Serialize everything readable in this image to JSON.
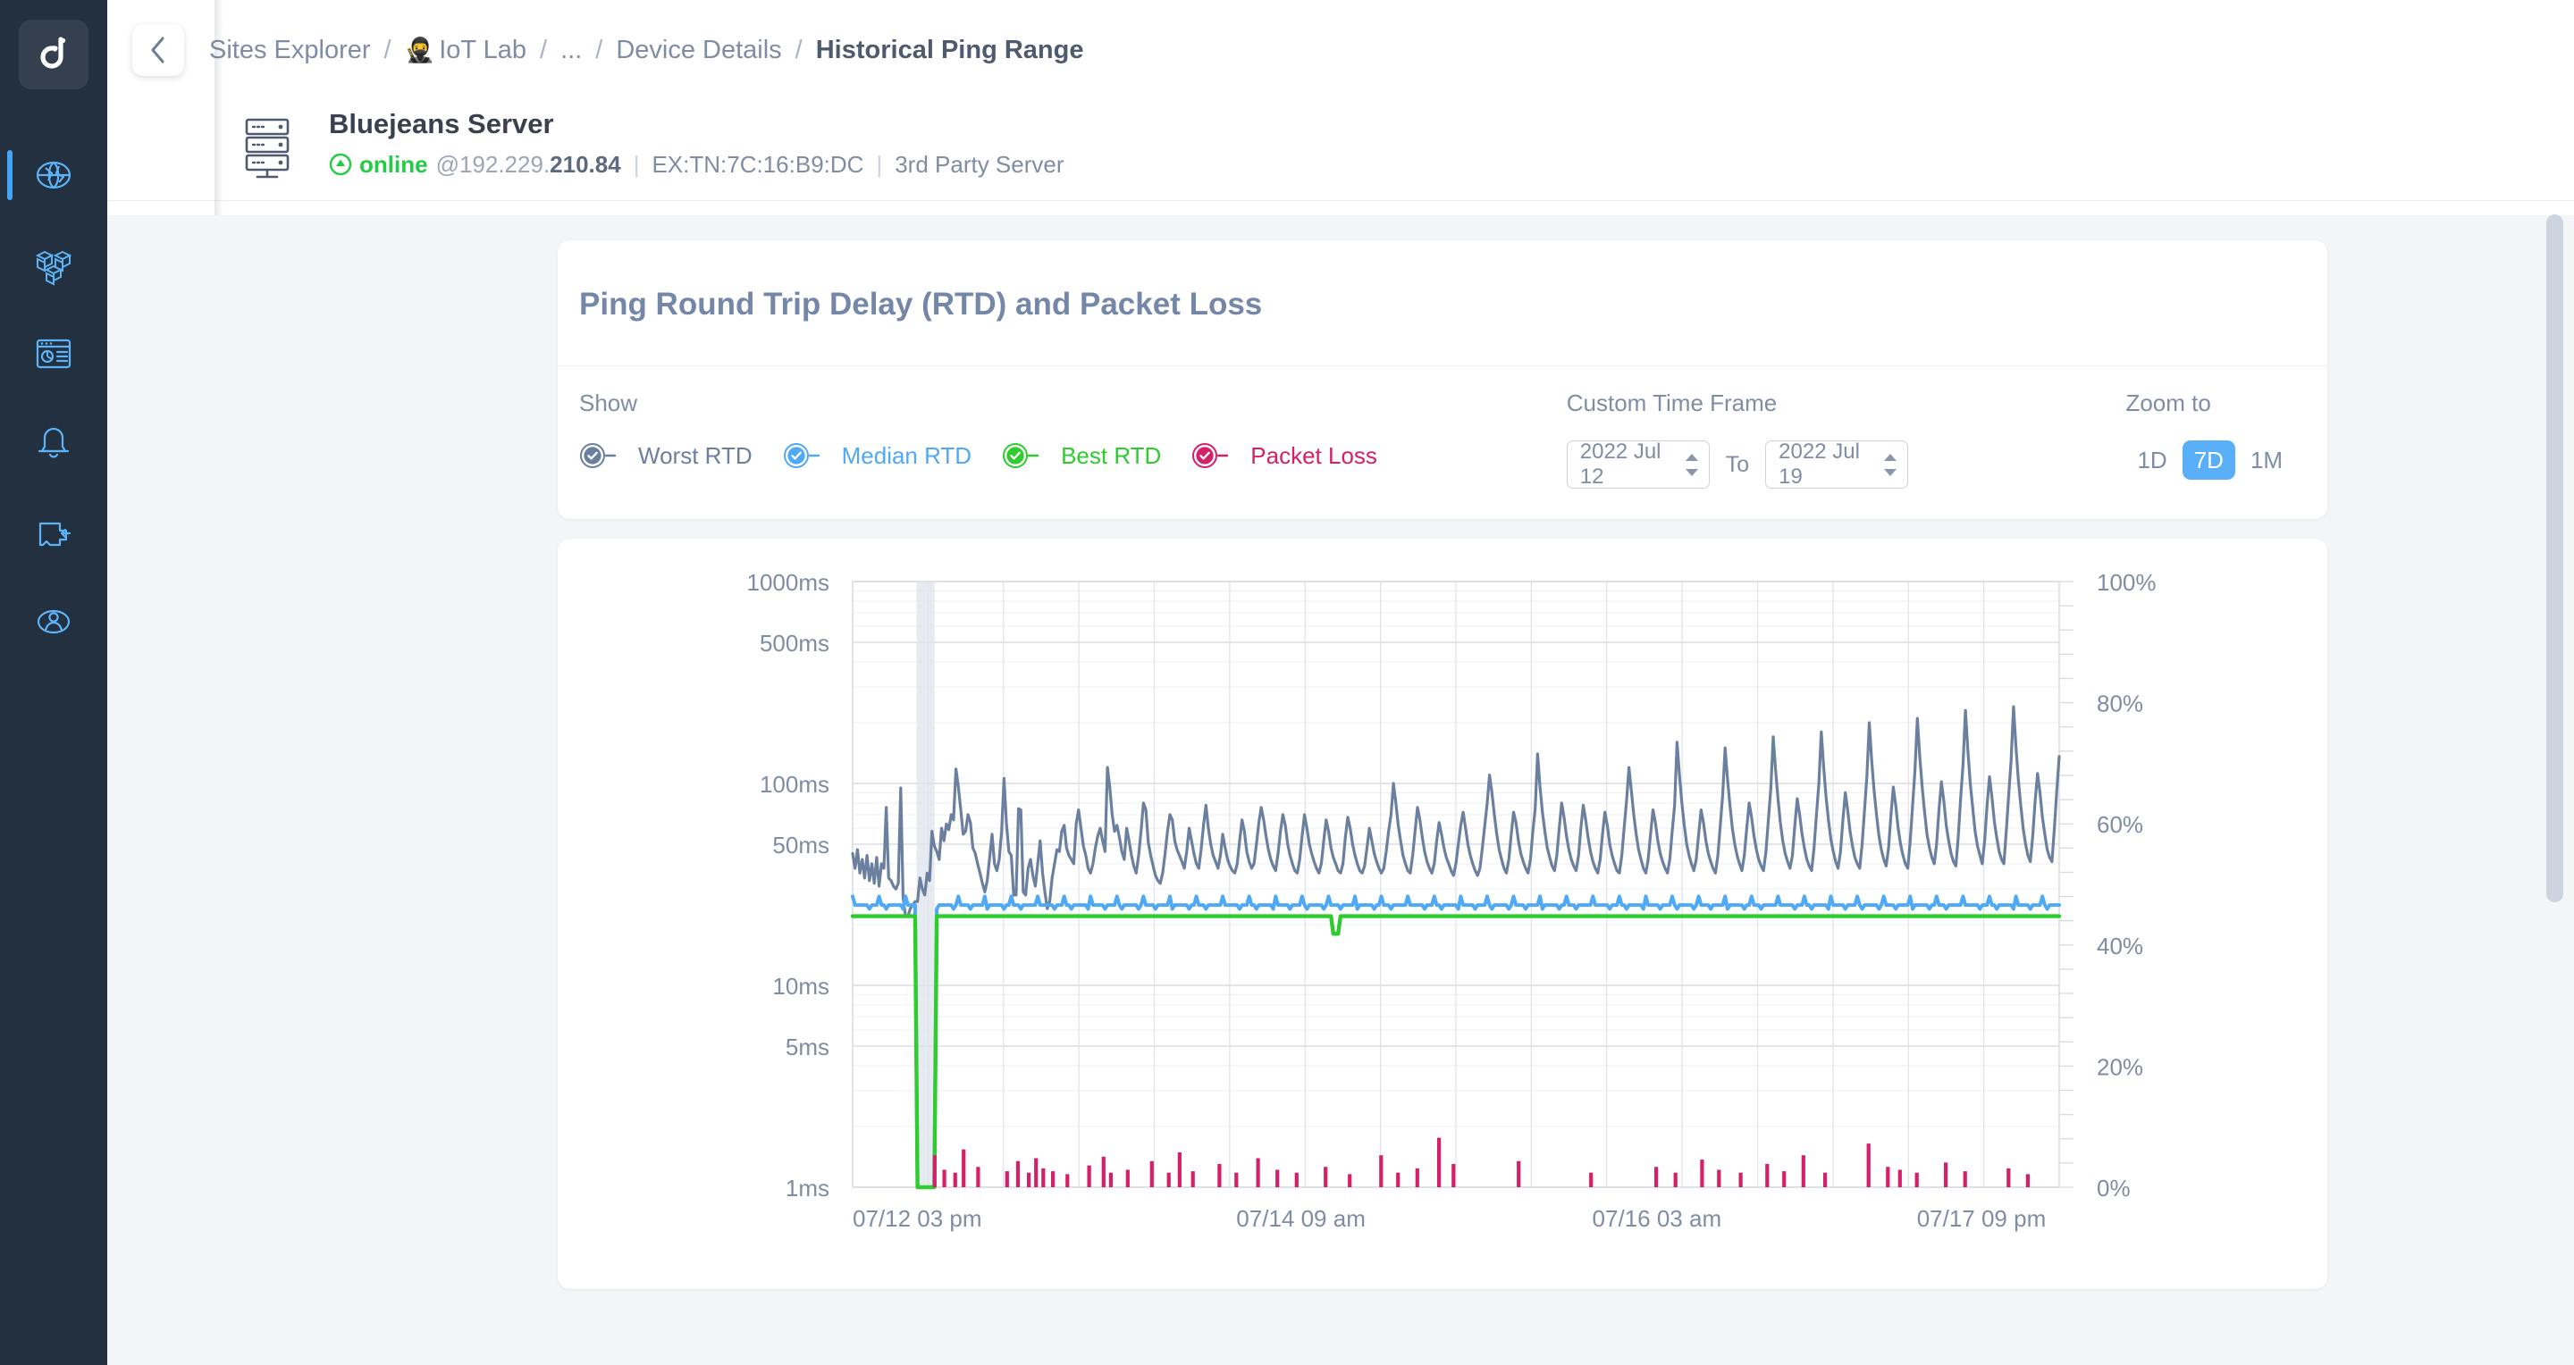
{
  "sidebar": {
    "logo_icon": "decision-logo-icon",
    "items": [
      {
        "icon": "globe-network-icon",
        "name": "sites",
        "active": true
      },
      {
        "icon": "cubes-inventory-icon",
        "name": "inventory",
        "active": false
      },
      {
        "icon": "dashboard-report-icon",
        "name": "reports",
        "active": false
      },
      {
        "icon": "bell-alerts-icon",
        "name": "alerts",
        "active": false
      },
      {
        "icon": "integration-icon",
        "name": "integrations",
        "active": false
      },
      {
        "icon": "user-profile-icon",
        "name": "profile",
        "active": false
      }
    ]
  },
  "header": {
    "back_icon": "chevron-left-icon",
    "breadcrumbs": [
      {
        "label": "Sites Explorer",
        "current": false,
        "emoji": ""
      },
      {
        "label": "IoT Lab",
        "current": false,
        "emoji": "🥷"
      },
      {
        "label": "...",
        "current": false,
        "emoji": ""
      },
      {
        "label": "Device Details",
        "current": false,
        "emoji": ""
      },
      {
        "label": "Historical Ping Range",
        "current": true,
        "emoji": ""
      }
    ],
    "separator": "/"
  },
  "device": {
    "icon": "server-rack-icon",
    "name": "Bluejeans Server",
    "status_icon": "up-arrow-circle-icon",
    "status": "online",
    "ip_prefix": "@192.229.",
    "ip_suffix": "210.84",
    "mac": "EX:TN:7C:16:B9:DC",
    "type": "3rd Party Server"
  },
  "panel": {
    "title": "Ping Round Trip Delay (RTD) and Packet Loss",
    "show_label": "Show",
    "series_toggles": [
      {
        "label": "Worst RTD",
        "color": "#6b7f9e",
        "checked": true
      },
      {
        "label": "Median RTD",
        "color": "#4fa9f5",
        "checked": true
      },
      {
        "label": "Best RTD",
        "color": "#2ecc2e",
        "checked": true
      },
      {
        "label": "Packet Loss",
        "color": "#d61f69",
        "checked": true
      }
    ],
    "timeframe_label": "Custom Time Frame",
    "date_from": "2022 Jul 12",
    "date_to": "2022 Jul 19",
    "to_label": "To",
    "zoom_label": "Zoom to",
    "zoom_options": [
      {
        "label": "1D",
        "active": false
      },
      {
        "label": "7D",
        "active": true
      },
      {
        "label": "1M",
        "active": false
      }
    ]
  },
  "chart_data": {
    "type": "line",
    "title": "Ping Round Trip Delay (RTD) and Packet Loss",
    "xlabel": "",
    "ylabel": "",
    "y_scale": "log",
    "ylim": [
      1,
      1000
    ],
    "y_ticks": [
      1,
      5,
      10,
      50,
      100,
      500,
      1000
    ],
    "y_tick_labels": [
      "1ms",
      "5ms",
      "10ms",
      "50ms",
      "100ms",
      "500ms",
      "1000ms"
    ],
    "y2_label": "",
    "y2_lim": [
      0,
      100
    ],
    "y2_ticks": [
      0,
      20,
      40,
      60,
      80,
      100
    ],
    "y2_tick_labels": [
      "0%",
      "20%",
      "40%",
      "60%",
      "80%",
      "100%"
    ],
    "x_tick_labels": [
      "07/12 03 pm",
      "07/14 09 am",
      "07/16 03 am",
      "07/17 09 pm"
    ],
    "x_tick_positions": [
      0.0,
      0.318,
      0.613,
      0.882
    ],
    "grid": true,
    "legend_position": "top",
    "highlight_band": {
      "start": 0.053,
      "end": 0.068,
      "color": "#dfe4ec"
    },
    "series": [
      {
        "name": "Worst RTD",
        "color": "#6b7f9e",
        "axis": "left",
        "unit": "ms",
        "values": [
          45,
          38,
          47,
          36,
          42,
          34,
          44,
          33,
          40,
          32,
          43,
          31,
          40,
          38,
          76,
          34,
          33,
          31,
          30,
          32,
          95,
          27,
          22,
          22,
          24,
          25,
          26,
          26,
          34,
          30,
          28,
          36,
          33,
          58,
          49,
          46,
          42,
          60,
          52,
          63,
          59,
          70,
          66,
          118,
          96,
          74,
          56,
          58,
          70,
          64,
          48,
          45,
          40,
          36,
          32,
          29,
          33,
          43,
          56,
          40,
          37,
          42,
          58,
          106,
          63,
          46,
          44,
          28,
          28,
          75,
          74,
          29,
          28,
          38,
          42,
          35,
          31,
          40,
          52,
          36,
          29,
          24,
          26,
          34,
          40,
          47,
          46,
          58,
          62,
          48,
          44,
          42,
          40,
          63,
          74,
          60,
          49,
          44,
          38,
          36,
          40,
          48,
          55,
          60,
          52,
          46,
          120,
          96,
          70,
          58,
          62,
          54,
          46,
          42,
          60,
          52,
          44,
          39,
          36,
          44,
          58,
          80,
          74,
          51,
          44,
          39,
          35,
          33,
          32,
          36,
          45,
          58,
          70,
          66,
          52,
          47,
          44,
          41,
          38,
          46,
          60,
          52,
          45,
          40,
          38,
          47,
          62,
          78,
          60,
          50,
          44,
          41,
          38,
          44,
          56,
          48,
          42,
          39,
          37,
          36,
          40,
          52,
          66,
          58,
          46,
          41,
          38,
          40,
          50,
          64,
          76,
          66,
          55,
          47,
          42,
          39,
          37,
          45,
          58,
          70,
          62,
          50,
          44,
          40,
          37,
          36,
          42,
          55,
          70,
          60,
          50,
          45,
          41,
          38,
          36,
          40,
          52,
          66,
          58,
          48,
          43,
          40,
          37,
          36,
          40,
          54,
          68,
          60,
          50,
          44,
          40,
          37,
          36,
          39,
          48,
          60,
          52,
          45,
          41,
          38,
          36,
          38,
          46,
          58,
          70,
          100,
          80,
          62,
          52,
          44,
          40,
          37,
          36,
          44,
          58,
          76,
          66,
          54,
          46,
          41,
          38,
          36,
          40,
          52,
          64,
          56,
          48,
          43,
          40,
          37,
          35,
          40,
          50,
          62,
          72,
          60,
          50,
          44,
          40,
          37,
          35,
          38,
          48,
          62,
          80,
          110,
          90,
          70,
          56,
          47,
          42,
          38,
          36,
          42,
          56,
          72,
          64,
          52,
          45,
          41,
          38,
          36,
          42,
          58,
          75,
          140,
          96,
          72,
          58,
          48,
          43,
          39,
          37,
          44,
          60,
          80,
          68,
          55,
          47,
          42,
          39,
          37,
          44,
          60,
          78,
          66,
          54,
          46,
          41,
          38,
          36,
          42,
          56,
          72,
          62,
          50,
          44,
          40,
          37,
          36,
          44,
          60,
          82,
          120,
          92,
          70,
          56,
          47,
          42,
          38,
          36,
          42,
          56,
          74,
          64,
          52,
          45,
          41,
          38,
          36,
          42,
          58,
          78,
          160,
          110,
          80,
          62,
          50,
          44,
          40,
          37,
          42,
          56,
          74,
          64,
          52,
          45,
          41,
          38,
          36,
          44,
          62,
          88,
          150,
          105,
          78,
          60,
          50,
          44,
          40,
          37,
          44,
          60,
          80,
          68,
          55,
          47,
          42,
          39,
          37,
          46,
          66,
          94,
          170,
          116,
          84,
          64,
          52,
          45,
          41,
          38,
          44,
          62,
          84,
          70,
          56,
          48,
          42,
          39,
          37,
          48,
          70,
          100,
          180,
          120,
          86,
          66,
          53,
          46,
          41,
          38,
          46,
          66,
          90,
          74,
          58,
          49,
          43,
          40,
          38,
          50,
          74,
          110,
          200,
          130,
          92,
          70,
          55,
          47,
          42,
          39,
          48,
          70,
          96,
          78,
          60,
          50,
          44,
          40,
          38,
          52,
          78,
          116,
          210,
          136,
          96,
          72,
          56,
          48,
          43,
          40,
          50,
          74,
          102,
          82,
          62,
          52,
          45,
          41,
          39,
          55,
          84,
          124,
          230,
          146,
          100,
          76,
          58,
          49,
          44,
          40,
          52,
          78,
          108,
          86,
          65,
          54,
          46,
          42,
          40,
          58,
          88,
          130,
          240,
          152,
          104,
          78,
          60,
          50,
          44,
          41,
          55,
          82,
          112,
          90,
          68,
          56,
          47,
          43,
          41,
          60,
          92,
          136
        ]
      },
      {
        "name": "Median RTD",
        "color": "#4fa9f5",
        "axis": "left",
        "unit": "ms",
        "constant": 25,
        "note": "Nearly flat near 25ms with tiny ripples; drops to ~1ms during the outage band near 07/12 evening."
      },
      {
        "name": "Best RTD",
        "color": "#2ecc2e",
        "axis": "left",
        "unit": "ms",
        "constant": 22,
        "note": "Flat near 22ms; full drop to 1ms during the outage band, and a small dip near 07/16."
      },
      {
        "name": "Packet Loss",
        "color": "#d61f69",
        "axis": "right",
        "unit": "%",
        "baseline": 0,
        "spikes_note": "Sparse thin spikes (1-6%) along the bottom across the whole range."
      }
    ]
  }
}
